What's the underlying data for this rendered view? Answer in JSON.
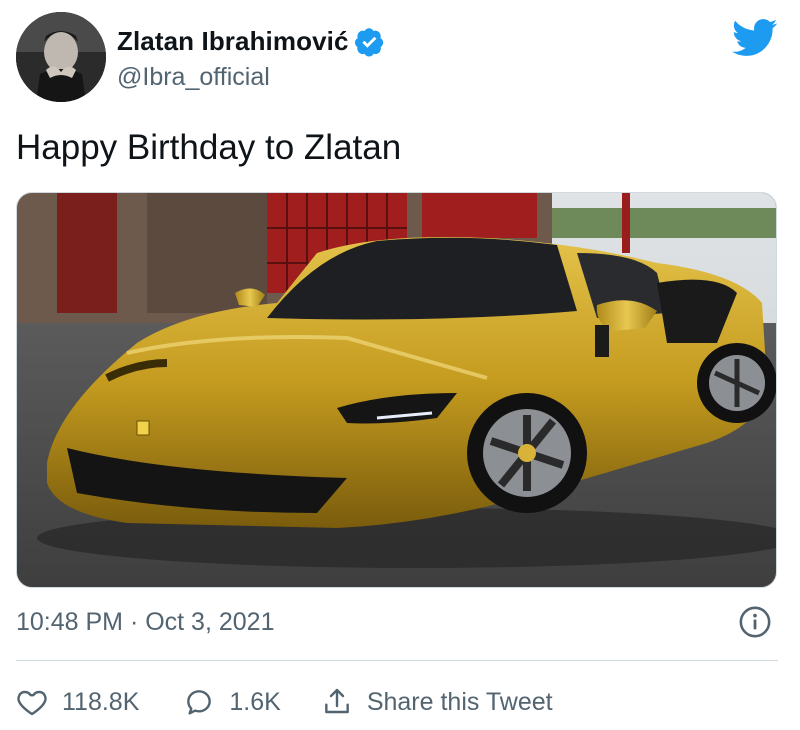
{
  "author": {
    "display_name": "Zlatan Ibrahimović",
    "handle": "@Ibra_official",
    "verified": true
  },
  "tweet": {
    "text": "Happy Birthday to Zlatan",
    "timestamp": "10:48 PM · Oct 3, 2021"
  },
  "actions": {
    "likes": "118.8K",
    "replies": "1.6K",
    "share_label": "Share this Tweet"
  },
  "icons": {
    "brand": "twitter-bird-icon",
    "verified": "verified-badge-icon",
    "info": "info-icon",
    "like": "heart-icon",
    "reply": "speech-bubble-icon",
    "share": "share-upload-icon"
  },
  "colors": {
    "twitter_blue": "#1d9bf0",
    "text_primary": "#0f1419",
    "text_secondary": "#536471",
    "divider": "#cfd9de",
    "car_gold": "#c9a227"
  }
}
